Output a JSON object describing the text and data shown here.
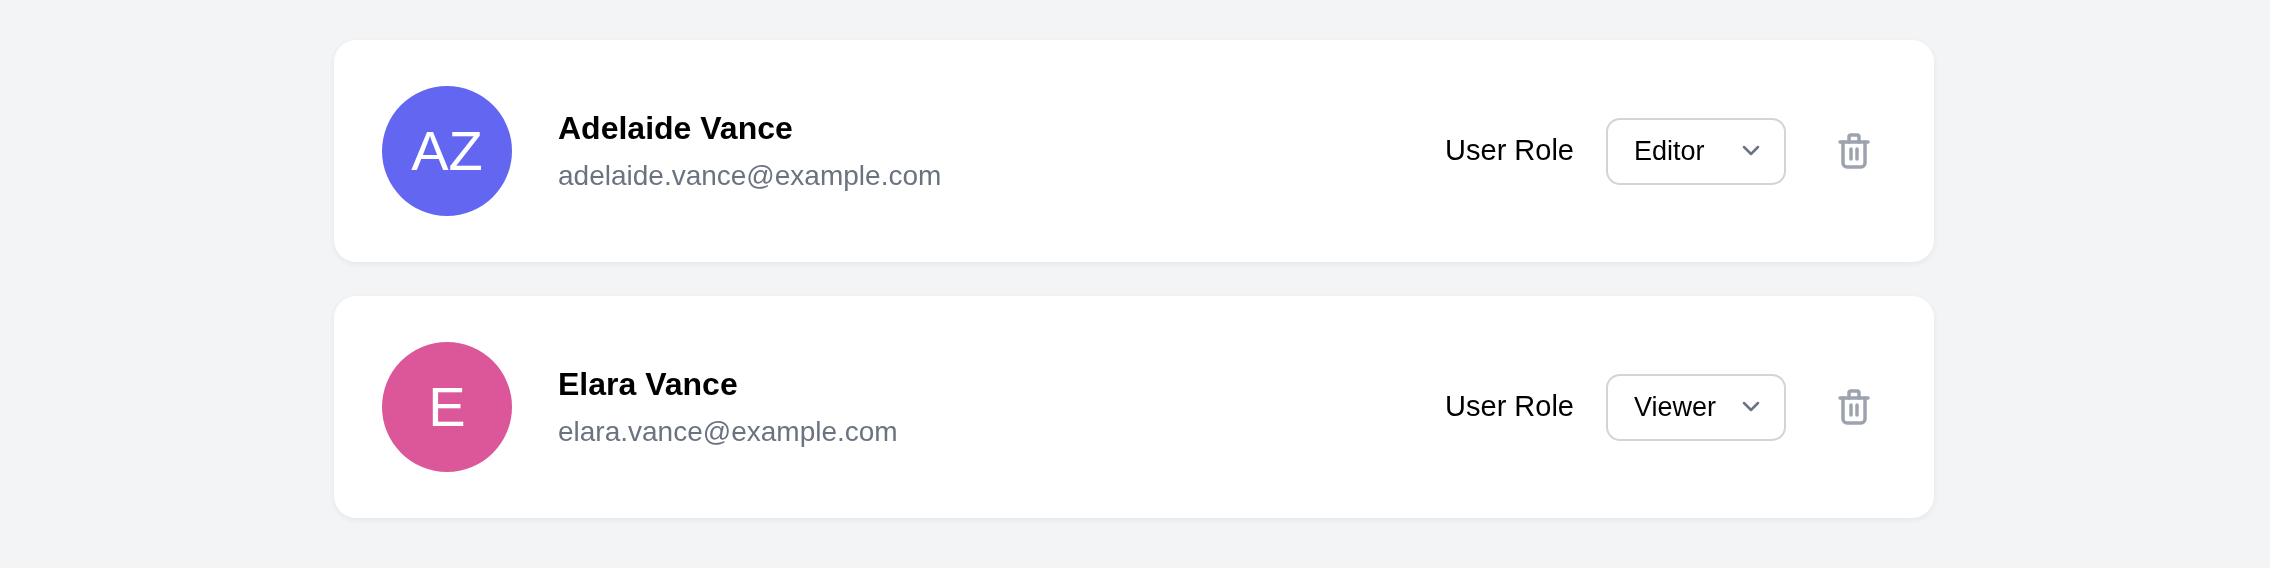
{
  "users": [
    {
      "initials": "AZ",
      "color": "#6366f1",
      "name": "Adelaide Vance",
      "email": "adelaide.vance@example.com",
      "role_label": "User Role",
      "role": "Editor"
    },
    {
      "initials": "E",
      "color": "#db5799",
      "name": "Elara Vance",
      "email": "elara.vance@example.com",
      "role_label": "User Role",
      "role": "Viewer"
    }
  ]
}
